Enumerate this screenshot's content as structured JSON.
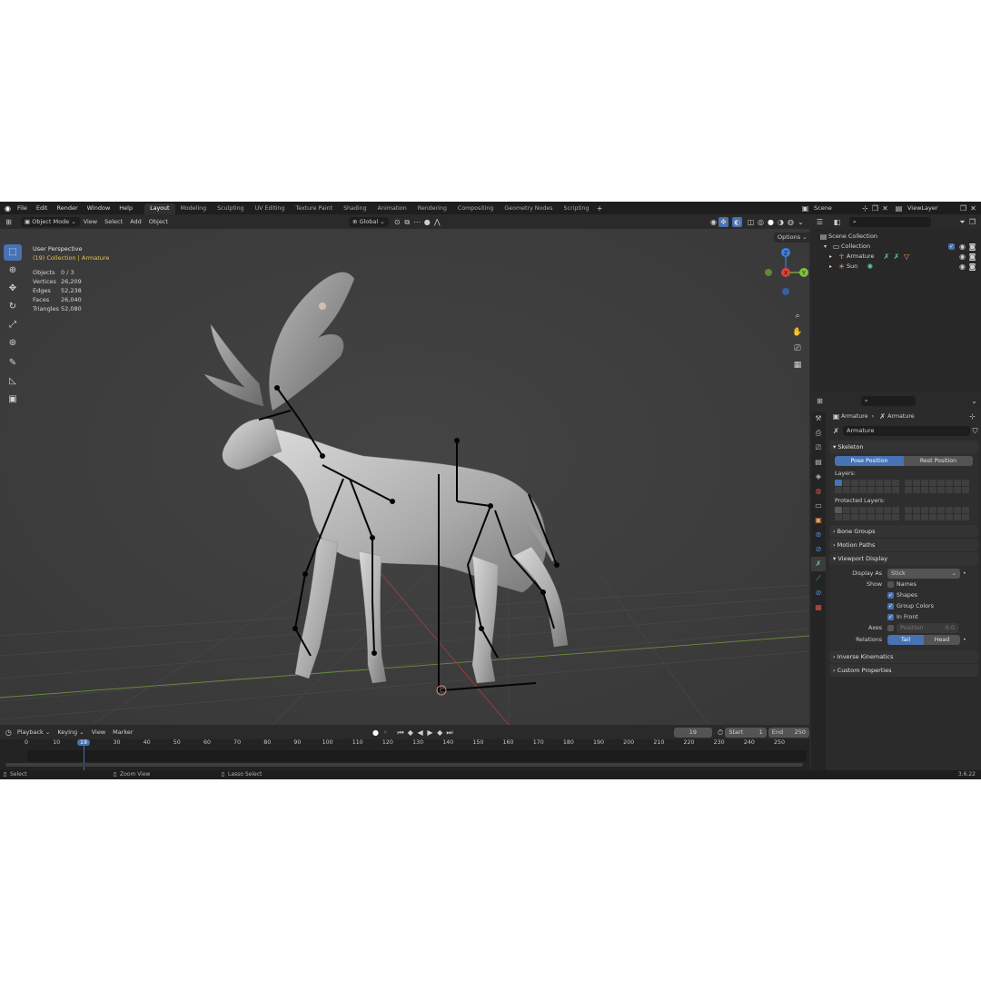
{
  "menu": {
    "items": [
      "File",
      "Edit",
      "Render",
      "Window",
      "Help"
    ]
  },
  "workspaces": [
    {
      "label": "Layout",
      "active": true
    },
    {
      "label": "Modeling"
    },
    {
      "label": "Sculpting"
    },
    {
      "label": "UV Editing"
    },
    {
      "label": "Texture Paint"
    },
    {
      "label": "Shading"
    },
    {
      "label": "Animation"
    },
    {
      "label": "Rendering"
    },
    {
      "label": "Compositing"
    },
    {
      "label": "Geometry Nodes"
    },
    {
      "label": "Scripting"
    }
  ],
  "scene": {
    "name": "Scene"
  },
  "view_layer": {
    "name": "ViewLayer"
  },
  "viewport_header": {
    "mode": "Object Mode",
    "menus": [
      "View",
      "Select",
      "Add",
      "Object"
    ],
    "transform_orientation": "Global",
    "options_label": "Options"
  },
  "viewport": {
    "title": "User Perspective",
    "subtitle": "(19) Collection | Armature",
    "stats": [
      {
        "label": "Objects",
        "value": "0 / 3"
      },
      {
        "label": "Vertices",
        "value": "26,209"
      },
      {
        "label": "Edges",
        "value": "52,238"
      },
      {
        "label": "Faces",
        "value": "26,040"
      },
      {
        "label": "Triangles",
        "value": "52,080"
      }
    ],
    "gizmo": {
      "x": "X",
      "y": "Y",
      "z": "Z"
    }
  },
  "timeline": {
    "menus": [
      "Playback",
      "Keying",
      "View",
      "Marker"
    ],
    "current_frame": "19",
    "start_label": "Start",
    "start": "1",
    "end_label": "End",
    "end": "250",
    "ticks": [
      "0",
      "10",
      "19",
      "30",
      "40",
      "50",
      "60",
      "70",
      "80",
      "90",
      "100",
      "110",
      "120",
      "130",
      "140",
      "150",
      "160",
      "170",
      "180",
      "190",
      "200",
      "210",
      "220",
      "230",
      "240",
      "250"
    ]
  },
  "statusbar": {
    "select": "Select",
    "zoom": "Zoom View",
    "lasso": "Lasso Select",
    "version": "3.6.22"
  },
  "outliner": {
    "root": "Scene Collection",
    "collection": "Collection",
    "items": [
      {
        "name": "Armature"
      },
      {
        "name": "Sun"
      }
    ]
  },
  "properties": {
    "breadcrumb": [
      "Armature",
      "Armature"
    ],
    "data_name": "Armature",
    "skeleton": {
      "title": "Skeleton",
      "pose_position": "Pose Position",
      "rest_position": "Rest Position",
      "layers_label": "Layers:",
      "protected_label": "Protected Layers:"
    },
    "panels_collapsed": [
      "Bone Groups",
      "Motion Paths"
    ],
    "viewport_display": {
      "title": "Viewport Display",
      "display_as_label": "Display As",
      "display_as": "Stick",
      "show_label": "Show",
      "options": [
        {
          "label": "Names",
          "checked": false
        },
        {
          "label": "Shapes",
          "checked": true
        },
        {
          "label": "Group Colors",
          "checked": true
        },
        {
          "label": "In Front",
          "checked": true
        }
      ],
      "axes_label": "Axes",
      "position_label": "Position",
      "position_value": "0.0",
      "relations_label": "Relations",
      "tail": "Tail",
      "head": "Head"
    },
    "panels_bottom": [
      "Inverse Kinematics",
      "Custom Properties"
    ]
  },
  "colors": {
    "accent": "#4772b3",
    "x_axis": "#e04040",
    "y_axis": "#7fbf3f",
    "z_axis": "#3f7fe0",
    "overlay_yellow": "#e8c44a"
  }
}
